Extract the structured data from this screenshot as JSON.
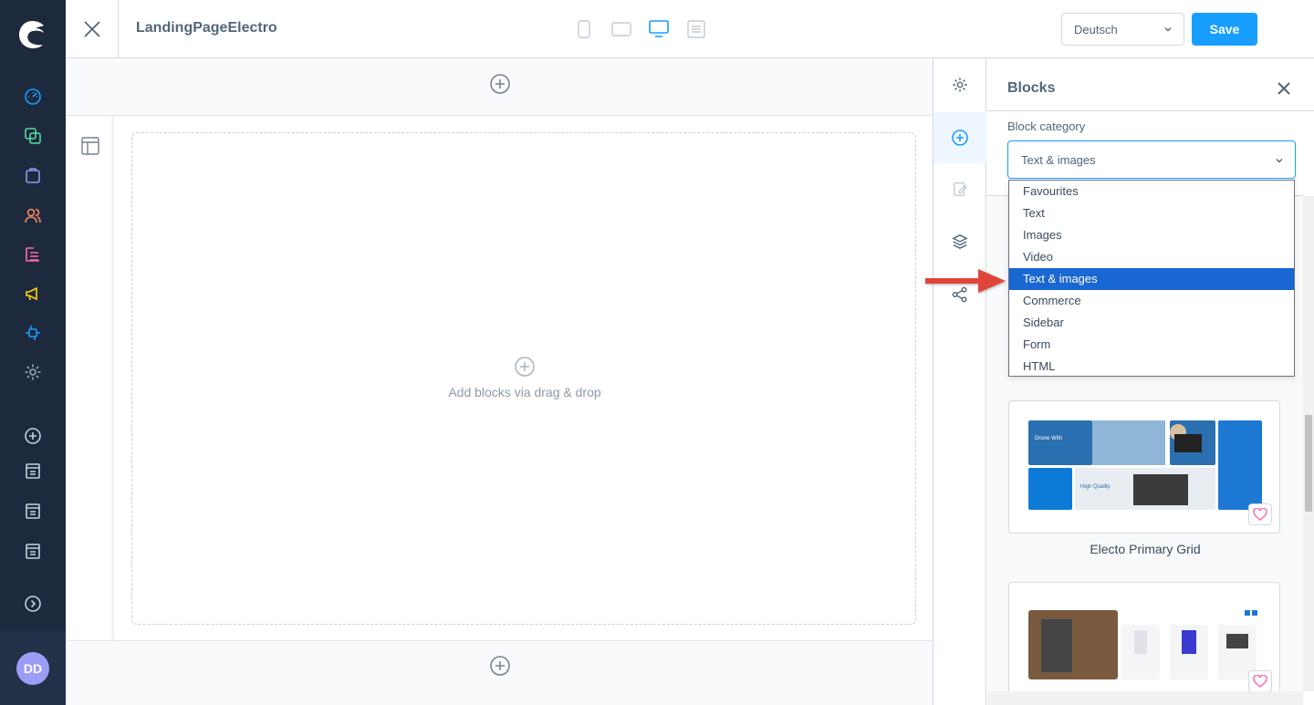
{
  "nav": {
    "items": [
      {
        "icon": "dashboard-icon",
        "color": "#189eff"
      },
      {
        "icon": "catalogue-icon",
        "color": "#57d9a3"
      },
      {
        "icon": "orders-icon",
        "color": "#a092f0"
      },
      {
        "icon": "customers-icon",
        "color": "#f88962"
      },
      {
        "icon": "content-icon",
        "color": "#ff68b4"
      },
      {
        "icon": "marketing-icon",
        "color": "#ffd700"
      },
      {
        "icon": "extensions-icon",
        "color": "#189eff"
      },
      {
        "icon": "settings-icon",
        "color": "#9aa8b5"
      }
    ],
    "avatar_initials": "DD"
  },
  "topbar": {
    "page_name": "LandingPageElectro",
    "language": "Deutsch",
    "save_label": "Save",
    "active_device": "desktop"
  },
  "canvas": {
    "dropzone_text": "Add blocks via drag & drop"
  },
  "panel": {
    "title": "Blocks",
    "category_label": "Block category",
    "category_value": "Text & images",
    "options": [
      "Favourites",
      "Text",
      "Images",
      "Video",
      "Text & images",
      "Commerce",
      "Sidebar",
      "Form",
      "HTML"
    ],
    "selected_option": "Text & images",
    "cards": [
      {
        "label": "Electo Primary Grid"
      },
      {
        "label": ""
      }
    ]
  },
  "colors": {
    "accent": "#189eff",
    "nav_bg": "#1d2a3d",
    "selected_option": "#1967d2",
    "arrow": "#e0453a",
    "heart": "#ff68b4"
  }
}
